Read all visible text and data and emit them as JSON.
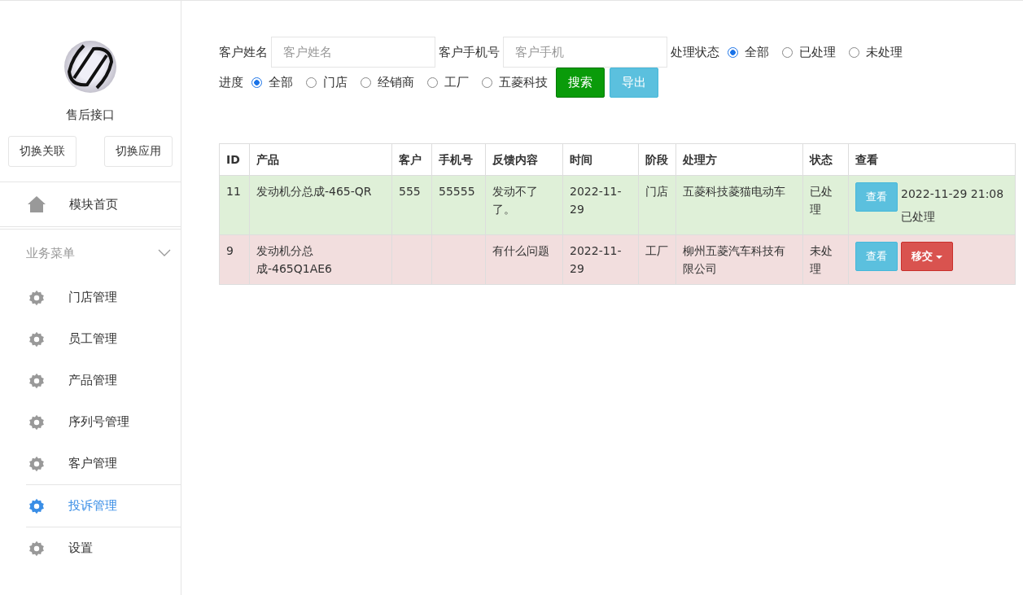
{
  "sidebar": {
    "app_name": "售后接口",
    "buttons": [
      "切换关联",
      "切换应用"
    ],
    "home": {
      "label": "模块首页"
    },
    "menu_group": {
      "label": "业务菜单",
      "expanded": true
    },
    "items": [
      {
        "label": "门店管理",
        "selected": false
      },
      {
        "label": "员工管理",
        "selected": false
      },
      {
        "label": "产品管理",
        "selected": false
      },
      {
        "label": "序列号管理",
        "selected": false
      },
      {
        "label": "客户管理",
        "selected": false
      },
      {
        "label": "投诉管理",
        "selected": true
      },
      {
        "label": "设置",
        "selected": false
      }
    ]
  },
  "filters": {
    "name": {
      "label": "客户姓名",
      "placeholder": "客户姓名"
    },
    "phone": {
      "label": "客户手机号",
      "placeholder": "客户手机"
    },
    "status": {
      "label": "处理状态",
      "options": [
        {
          "label": "全部",
          "selected": true
        },
        {
          "label": "已处理",
          "selected": false
        },
        {
          "label": "未处理",
          "selected": false
        }
      ]
    },
    "progress": {
      "label": "进度",
      "options": [
        {
          "label": "全部",
          "selected": true
        },
        {
          "label": "门店",
          "selected": false
        },
        {
          "label": "经销商",
          "selected": false
        },
        {
          "label": "工厂",
          "selected": false
        },
        {
          "label": "五菱科技",
          "selected": false
        }
      ]
    },
    "search_button": "搜索",
    "export_button": "导出"
  },
  "table": {
    "columns": [
      "ID",
      "产品",
      "客户",
      "手机号",
      "反馈内容",
      "时间",
      "阶段",
      "处理方",
      "状态",
      "查看"
    ],
    "rows": [
      {
        "kind": "success",
        "cells": [
          "11",
          "发动机分总成-465-QR",
          "555",
          "55555",
          "发动不了了。",
          "2022-11-29",
          "门店",
          "五菱科技菱猫电动车",
          "已处理"
        ],
        "actions": [
          {
            "kind": "info",
            "label": "查看"
          }
        ],
        "note": "2022-11-29 21:08已处理"
      },
      {
        "kind": "danger",
        "cells": [
          "9",
          "发动机分总成-465Q1AE6",
          "",
          "",
          "有什么问题",
          "2022-11-29",
          "工厂",
          "柳州五菱汽车科技有限公司",
          "未处理"
        ],
        "actions": [
          {
            "kind": "info",
            "label": "查看"
          },
          {
            "kind": "dropdown",
            "label": "移交"
          }
        ]
      }
    ]
  }
}
